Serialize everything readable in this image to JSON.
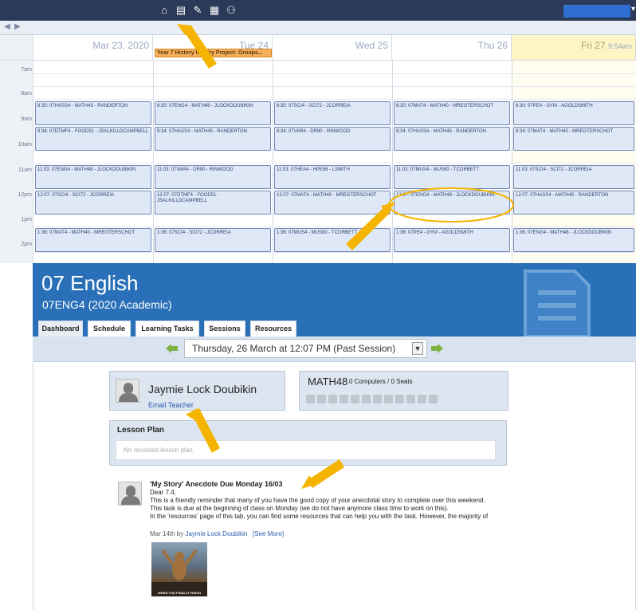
{
  "calendar": {
    "days": [
      {
        "label": "Mar 23, 2020",
        "extra": ""
      },
      {
        "label": "Tue 24",
        "extra": ""
      },
      {
        "label": "Wed 25",
        "extra": ""
      },
      {
        "label": "Thu 26",
        "extra": ""
      },
      {
        "label": "Fri 27",
        "extra": "9:54am"
      }
    ],
    "allday_event": "Year 7 History Inquiry Project- Groups...",
    "times": [
      "7am",
      "8am",
      "9am",
      "10am",
      "11am",
      "12pm",
      "1pm",
      "2pm"
    ],
    "rows": [
      [
        "8:30: 07HASS4 - MATH45 - RANDERTON",
        "8:30: 07ENG4 - MATH48 - JLOCKDOUBIKIN",
        "8:30: 07SCI4 - SCI72 - JCORREIA",
        "8:30: 07MAT4 - MATH40 - MREGTERSCHOT",
        "8:30: 07PE4 - GYM - AGOLDSMITH"
      ],
      [
        "9:34: 07DTMF4 - FOOD51 - JSALKILLDCAMPBELL",
        "9:34: 07HASS4 - MATH45 - RANDERTON",
        "9:34: 07VAR4 - DR90 - RINWOOD",
        "9:34: 07HASS4 - MATH45 - RANDERTON",
        "9:34: 07MAT4 - MATH40 - MREGTERSCHOT"
      ],
      [
        "11:03: 07ENG4 - MATH48 - JLOCKDOUBIKIN",
        "11:03: 07VAR4 - DR90 - RINWOOD",
        "11:03: 07HEA4 - HPE96 - LSMITH",
        "11:03: 07MUS4 - MUS80 - TCORBETT",
        "11:03: 07SCI4 - SCI72 - JCORREIA"
      ],
      [
        "12:07: 07SCI4 - SCI72 - JCORREIA",
        "12:07: 07DTMF4 - FOOD51 - JSALKILLDCAMPBELL",
        "12:07: 07MAT4 - MATH40 - MREGTERSCHOT",
        "12:07: 07ENG4 - MATH48 - JLOCKDOUBIKIN",
        "12:07: 07HASS4 - MATH45 - RANDERTON"
      ],
      [
        "1:36: 07MAT4 - MATH40 - MREGTERSCHOT",
        "1:36: 07SCI4 - SCI72 - JCORREIA",
        "1:36: 07MUS4 - MUS80 - TCORBETT",
        "1:36: 07PE4 - GYM - AGOLDSMITH",
        "1:36: 07ENG4 - MATH48 - JLOCKDOUBIKIN"
      ]
    ]
  },
  "dashboard": {
    "title": "07 English",
    "subtitle": "07ENG4 (2020 Academic)",
    "tabs": [
      "Dashboard",
      "Schedule",
      "Learning Tasks",
      "Sessions",
      "Resources"
    ],
    "session": "Thursday, 26 March at 12:07 PM (Past Session)",
    "teacher": {
      "name": "Jaymie Lock Doubikin",
      "email_label": "Email Teacher"
    },
    "room": {
      "name": "MATH48",
      "info": "0 Computers / 0 Seats"
    },
    "lesson_plan": {
      "title": "Lesson Plan",
      "empty": "No recorded lesson plan."
    },
    "post": {
      "title": "'My Story' Anecdote Due Monday 16/03",
      "lines": [
        "Dear 7.4,",
        "This is a friendly reminder that many of you have the good copy of your anecdotal story to complete over this weekend.",
        "This task is due at the beginning of class on Monday (we do not have anymore class time to work on this).",
        "In the 'resources' page of this tab, you can find some resources that can help you with the task. However, the majority of"
      ],
      "date": "Mar 14th by",
      "author": "Jaymie Lock Doubikin",
      "see_more": "[See More]",
      "image_caption": "WHEN YOU FINALLY FINISH"
    }
  },
  "colors": {
    "header_blue": "#2a70b8",
    "topbar_navy": "#2b3a58",
    "event_fill": "#dfe8f7",
    "annotation_arrow": "#f5b400"
  }
}
